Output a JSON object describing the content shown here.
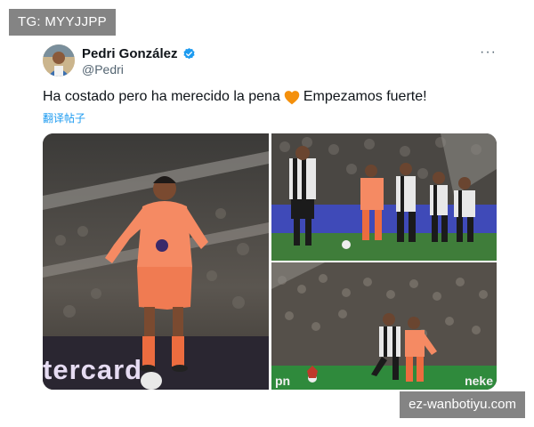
{
  "watermarks": {
    "top": "TG: MYYJJPP",
    "bottom": "ez-wanbotiyu.com"
  },
  "tweet": {
    "author_name": "Pedri González",
    "handle": "@Pedri",
    "text_before": "Ha costado pero ha merecido la pena",
    "text_after": "Empezamos fuerte!",
    "translate_label": "翻译帖子",
    "more_label": "···",
    "heart_color": "#f4900c",
    "verified_color": "#1d9bf0"
  },
  "media": {
    "photo1_board": "tercard",
    "photo3_board_left": "pn",
    "photo3_board_right": "neke"
  }
}
